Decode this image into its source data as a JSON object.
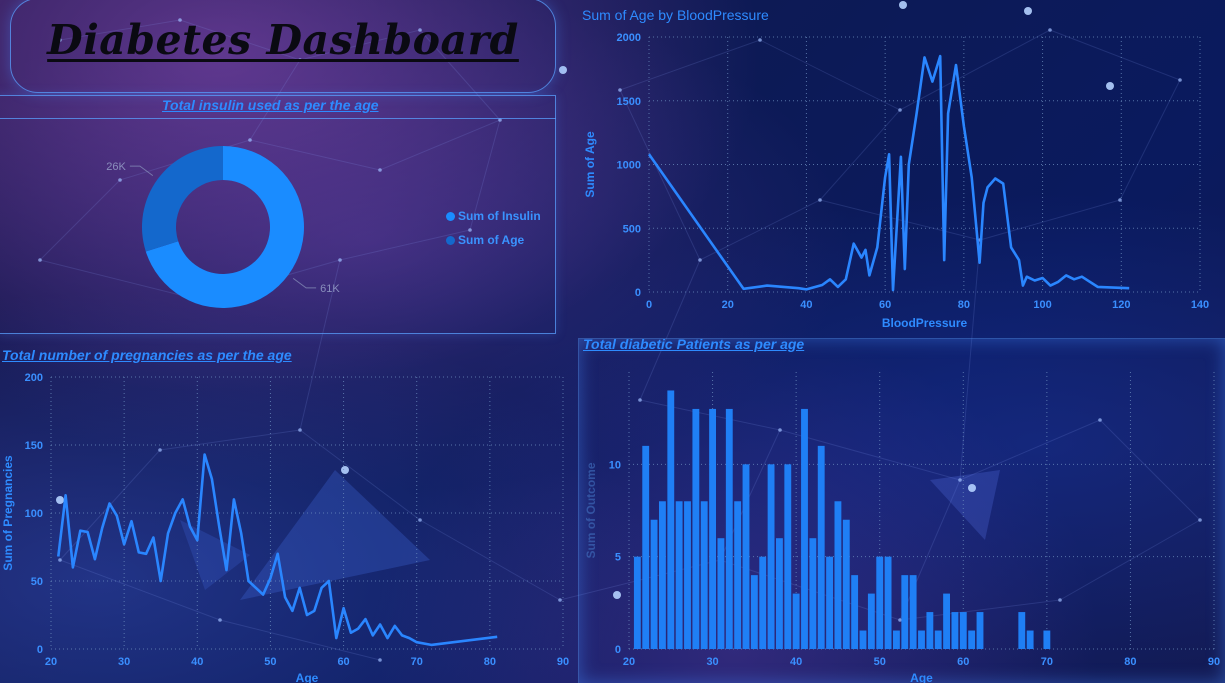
{
  "dashboard": {
    "title": "Diabetes Dashboard"
  },
  "colors": {
    "accent": "#2e8bff",
    "bar": "#1f7ff5",
    "donut_insulin": "#1a8cff",
    "donut_age": "#1468cc",
    "grid": "#6d8fbf"
  },
  "chart_data": [
    {
      "id": "donut",
      "type": "pie",
      "title": "Total insulin used as per the age",
      "labels": [
        "Sum of Insulin",
        "Sum of Age"
      ],
      "values": [
        61000,
        26000
      ],
      "data_labels": [
        "61K",
        "26K"
      ],
      "legend": "right"
    },
    {
      "id": "bp",
      "type": "line",
      "title": "Sum of Age by BloodPressure",
      "xlabel": "BloodPressure",
      "ylabel": "Sum of Age",
      "xlim": [
        0,
        140
      ],
      "ylim": [
        0,
        2000
      ],
      "xticks": [
        0,
        20,
        40,
        60,
        80,
        100,
        120,
        140
      ],
      "yticks": [
        0,
        500,
        1000,
        1500,
        2000
      ],
      "grid": true,
      "x": [
        0,
        24,
        30,
        38,
        40,
        44,
        46,
        48,
        50,
        52,
        54,
        55,
        56,
        58,
        60,
        61,
        62,
        64,
        65,
        66,
        68,
        70,
        72,
        74,
        75,
        76,
        78,
        80,
        82,
        84,
        85,
        86,
        88,
        90,
        92,
        94,
        95,
        96,
        98,
        100,
        102,
        104,
        106,
        108,
        110,
        114,
        122
      ],
      "y": [
        1080,
        25,
        50,
        30,
        20,
        55,
        100,
        40,
        100,
        380,
        270,
        330,
        130,
        350,
        900,
        1080,
        15,
        1060,
        180,
        1000,
        1400,
        1840,
        1650,
        1850,
        250,
        1400,
        1780,
        1300,
        900,
        230,
        700,
        820,
        890,
        850,
        350,
        250,
        50,
        120,
        90,
        110,
        50,
        80,
        130,
        100,
        120,
        40,
        30
      ]
    },
    {
      "id": "preg",
      "type": "line",
      "title": "Total number of pregnancies as per the age",
      "xlabel": "Age",
      "ylabel": "Sum of Pregnancies",
      "xlim": [
        20,
        90
      ],
      "ylim": [
        0,
        200
      ],
      "xticks": [
        20,
        30,
        40,
        50,
        60,
        70,
        80,
        90
      ],
      "yticks": [
        0,
        50,
        100,
        150,
        200
      ],
      "grid": true,
      "x": [
        21,
        22,
        23,
        24,
        25,
        26,
        27,
        28,
        29,
        30,
        31,
        32,
        33,
        34,
        35,
        36,
        37,
        38,
        39,
        40,
        41,
        42,
        43,
        44,
        45,
        46,
        47,
        48,
        49,
        50,
        51,
        52,
        53,
        54,
        55,
        56,
        57,
        58,
        59,
        60,
        61,
        62,
        63,
        64,
        65,
        66,
        67,
        68,
        69,
        70,
        72,
        81
      ],
      "y": [
        68,
        113,
        60,
        87,
        86,
        66,
        89,
        107,
        98,
        77,
        94,
        71,
        70,
        82,
        50,
        85,
        100,
        110,
        90,
        80,
        143,
        125,
        90,
        58,
        110,
        85,
        50,
        45,
        40,
        52,
        70,
        38,
        28,
        45,
        25,
        28,
        45,
        50,
        8,
        30,
        12,
        15,
        22,
        10,
        18,
        8,
        17,
        10,
        8,
        5,
        3,
        9
      ]
    },
    {
      "id": "outcome",
      "type": "bar",
      "title": "Total diabetic Patients as per age",
      "xlabel": "Age",
      "ylabel": "Sum of Outcome",
      "xlim": [
        20,
        90
      ],
      "ylim": [
        0,
        15
      ],
      "xticks": [
        20,
        30,
        40,
        50,
        60,
        70,
        80,
        90
      ],
      "yticks": [
        0,
        5,
        10
      ],
      "grid": true,
      "categories": [
        21,
        22,
        23,
        24,
        25,
        26,
        27,
        28,
        29,
        30,
        31,
        32,
        33,
        34,
        35,
        36,
        37,
        38,
        39,
        40,
        41,
        42,
        43,
        44,
        45,
        46,
        47,
        48,
        49,
        50,
        51,
        52,
        53,
        54,
        55,
        56,
        57,
        58,
        59,
        60,
        61,
        62,
        63,
        64,
        65,
        66,
        67,
        68,
        69,
        70
      ],
      "values": [
        5,
        11,
        7,
        8,
        14,
        8,
        8,
        13,
        8,
        13,
        6,
        13,
        8,
        10,
        4,
        5,
        10,
        6,
        10,
        3,
        13,
        6,
        11,
        5,
        8,
        7,
        4,
        1,
        3,
        5,
        5,
        1,
        4,
        4,
        1,
        2,
        1,
        3,
        2,
        2,
        1,
        2,
        0,
        0,
        0,
        0,
        2,
        1,
        0,
        1
      ]
    }
  ]
}
